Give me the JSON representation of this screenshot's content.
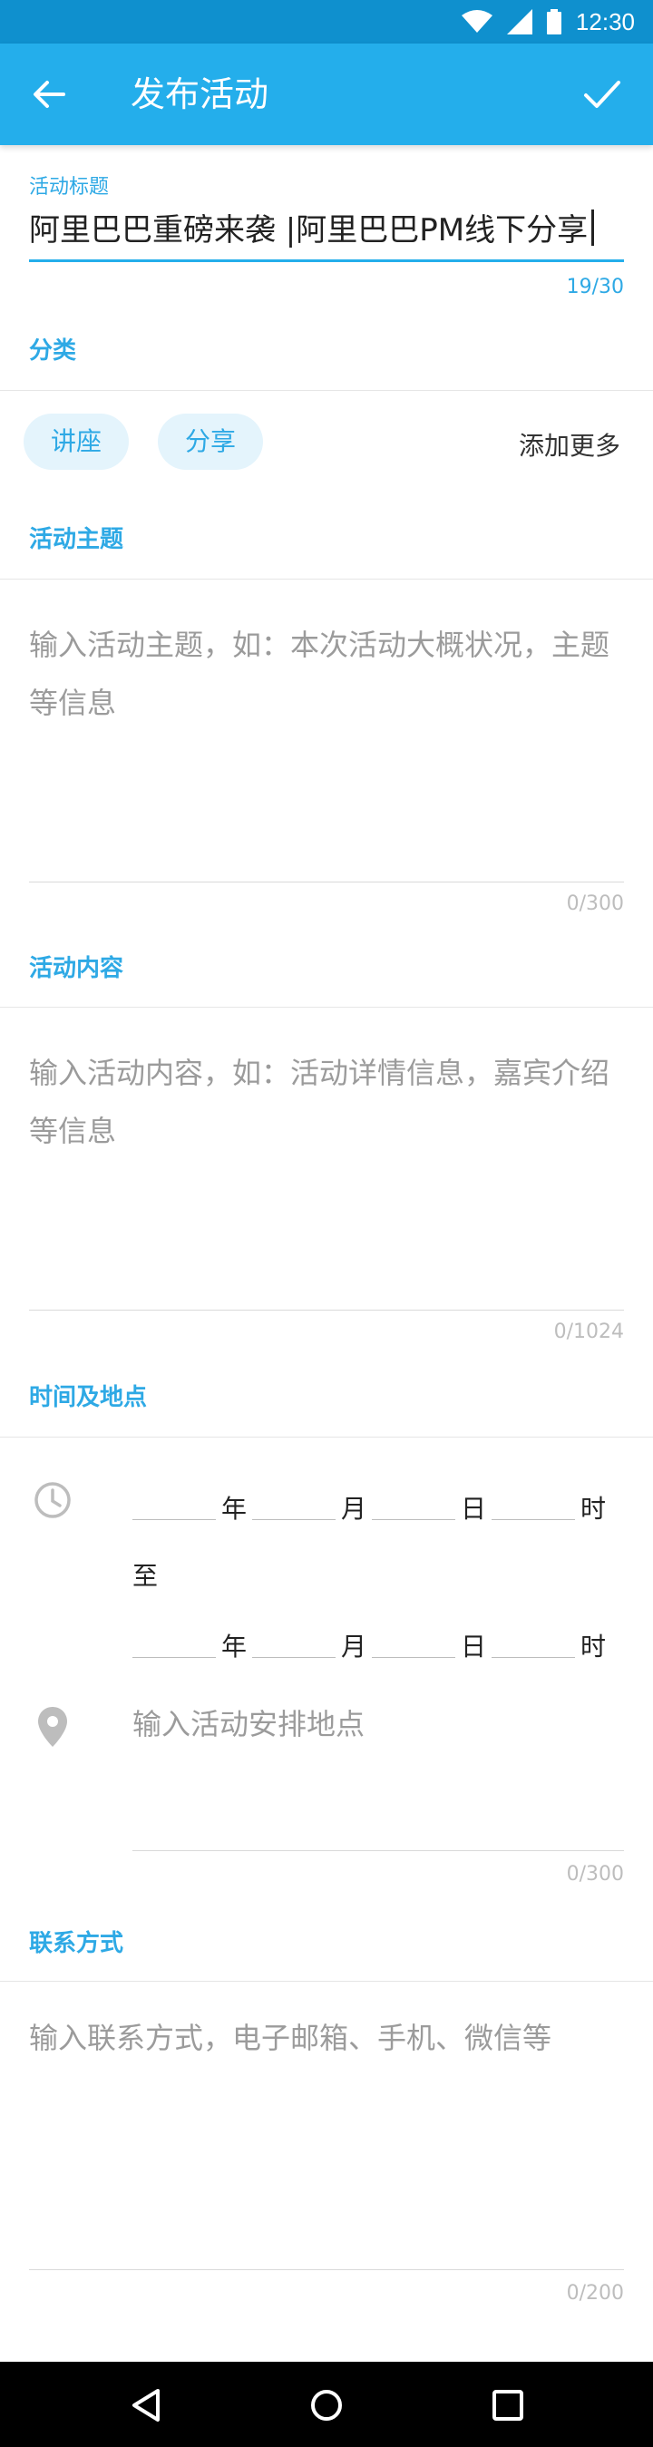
{
  "status_bar": {
    "time": "12:30"
  },
  "app_bar": {
    "title": "发布活动"
  },
  "event_title": {
    "label": "活动标题",
    "value": "阿里巴巴重磅来袭 |阿里巴巴PM线下分享",
    "counter": "19/30"
  },
  "category": {
    "label": "分类",
    "chips": [
      "讲座",
      "分享"
    ],
    "add_more": "添加更多"
  },
  "theme": {
    "label": "活动主题",
    "placeholder_line1": "输入活动主题，如：本次活动大概状况，主题",
    "placeholder_line2": "等信息",
    "counter": "0/300"
  },
  "content": {
    "label": "活动内容",
    "placeholder_line1": "输入活动内容，如：活动详情信息，嘉宾介绍",
    "placeholder_line2": "等信息",
    "counter": "0/1024"
  },
  "time_location": {
    "label": "时间及地点",
    "units": {
      "year": "年",
      "month": "月",
      "day": "日",
      "hour": "时"
    },
    "to": "至",
    "location_placeholder": "输入活动安排地点",
    "location_counter": "0/300"
  },
  "contact": {
    "label": "联系方式",
    "placeholder": "输入联系方式，电子邮箱、手机、微信等",
    "counter": "0/200"
  },
  "colors": {
    "accent": "#24aeeb",
    "status": "#0f90ce",
    "chip_bg": "#e4f4fc"
  }
}
